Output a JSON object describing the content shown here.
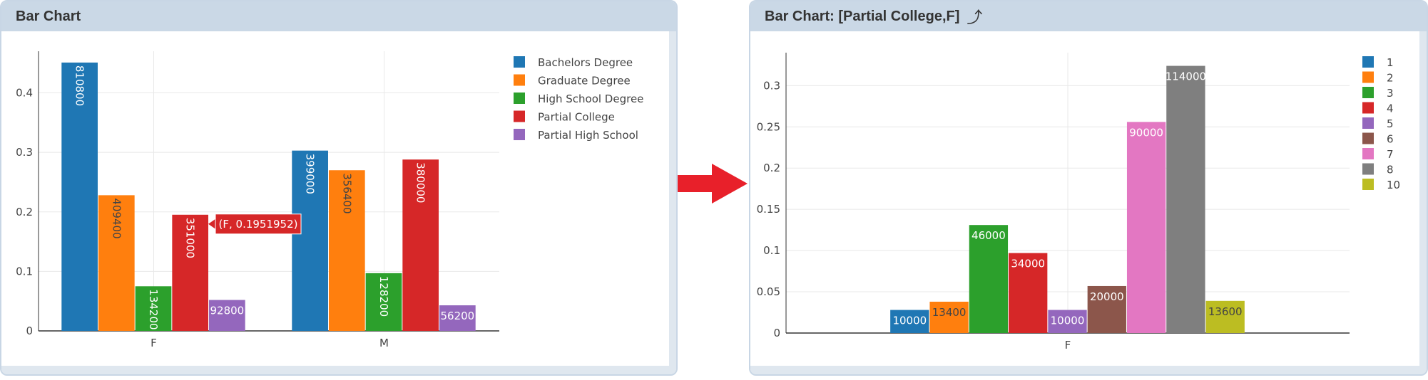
{
  "left_panel": {
    "title": "Bar Chart"
  },
  "right_panel": {
    "title": "Bar Chart: [Partial College,F]",
    "expand_icon": "⤴"
  },
  "colors": {
    "header_bg": "#cad8e6",
    "arrow": "#e8202a"
  },
  "chart_data": [
    {
      "type": "bar",
      "categories": [
        "F",
        "M"
      ],
      "ylim": [
        0,
        0.47
      ],
      "yticks": [
        0,
        0.1,
        0.2,
        0.3,
        0.4
      ],
      "ytick_labels": [
        "0",
        "0.1",
        "0.2",
        "0.3",
        "0.4"
      ],
      "grid": true,
      "legend": "top-right",
      "series": [
        {
          "name": "Bachelors Degree",
          "color": "#1f77b4",
          "values": [
            0.451,
            0.303
          ],
          "labels": [
            "810800",
            "399000"
          ]
        },
        {
          "name": "Graduate Degree",
          "color": "#ff7f0e",
          "values": [
            0.228,
            0.27
          ],
          "labels": [
            "409400",
            "356400"
          ]
        },
        {
          "name": "High School Degree",
          "color": "#2ca02c",
          "values": [
            0.075,
            0.097
          ],
          "labels": [
            "134200",
            "128200"
          ]
        },
        {
          "name": "Partial College",
          "color": "#d62728",
          "values": [
            0.1951952,
            0.288
          ],
          "labels": [
            "351000",
            "380000"
          ]
        },
        {
          "name": "Partial High School",
          "color": "#9467bd",
          "values": [
            0.052,
            0.043
          ],
          "labels": [
            "92800",
            "56200"
          ]
        }
      ],
      "tooltip": {
        "text": "(F, 0.1951952)",
        "series": "Partial College",
        "category": "F"
      }
    },
    {
      "type": "bar",
      "categories": [
        "F"
      ],
      "ylim": [
        0,
        0.34
      ],
      "yticks": [
        0,
        0.05,
        0.1,
        0.15,
        0.2,
        0.25,
        0.3
      ],
      "ytick_labels": [
        "0",
        "0.05",
        "0.1",
        "0.15",
        "0.2",
        "0.25",
        "0.3"
      ],
      "grid": true,
      "legend": "top-right",
      "series": [
        {
          "name": "1",
          "color": "#1f77b4",
          "values": [
            0.028
          ],
          "labels": [
            "10000"
          ]
        },
        {
          "name": "2",
          "color": "#ff7f0e",
          "values": [
            0.038
          ],
          "labels": [
            "13400"
          ]
        },
        {
          "name": "3",
          "color": "#2ca02c",
          "values": [
            0.131
          ],
          "labels": [
            "46000"
          ]
        },
        {
          "name": "4",
          "color": "#d62728",
          "values": [
            0.097
          ],
          "labels": [
            "34000"
          ]
        },
        {
          "name": "5",
          "color": "#9467bd",
          "values": [
            0.028
          ],
          "labels": [
            "10000"
          ]
        },
        {
          "name": "6",
          "color": "#8c564b",
          "values": [
            0.057
          ],
          "labels": [
            "20000"
          ]
        },
        {
          "name": "7",
          "color": "#e377c2",
          "values": [
            0.256
          ],
          "labels": [
            "90000"
          ]
        },
        {
          "name": "8",
          "color": "#7f7f7f",
          "values": [
            0.324
          ],
          "labels": [
            "114000"
          ]
        },
        {
          "name": "10",
          "color": "#bcbd22",
          "values": [
            0.039
          ],
          "labels": [
            "13600"
          ]
        }
      ]
    }
  ]
}
